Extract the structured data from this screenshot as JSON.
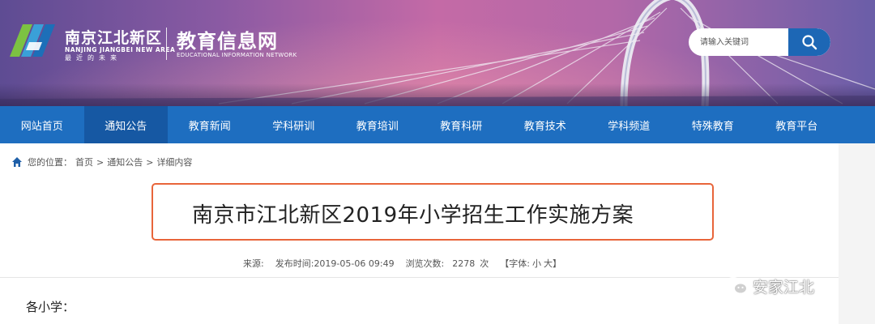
{
  "header": {
    "brand_cn": "南京江北新区",
    "brand_en": "NANJING JIANGBEI NEW AREA",
    "brand_slogan": "最近的未来",
    "site_title": "教育信息网",
    "site_subtitle": "EDUCATIONAL INFORMATION NETWORK",
    "search": {
      "placeholder": "请输入关键词"
    }
  },
  "nav": {
    "items": [
      {
        "label": "网站首页"
      },
      {
        "label": "通知公告"
      },
      {
        "label": "教育新闻"
      },
      {
        "label": "学科研训"
      },
      {
        "label": "教育培训"
      },
      {
        "label": "教育科研"
      },
      {
        "label": "教育技术"
      },
      {
        "label": "学科频道"
      },
      {
        "label": "特殊教育"
      },
      {
        "label": "教育平台"
      }
    ],
    "active_index": 1
  },
  "breadcrumb": {
    "prefix": "您的位置：",
    "items": [
      "首页",
      ">",
      "通知公告",
      ">",
      "详细内容"
    ]
  },
  "article": {
    "title": "南京市江北新区2019年小学招生工作实施方案",
    "meta": {
      "source_label": "来源:",
      "publish_label": "发布时间:",
      "publish_time": "2019-05-06 09:49",
      "views_label": "浏览次数:",
      "views": "2278",
      "views_unit": "次",
      "font_label": "【字体:",
      "font_small": "小",
      "font_large": "大",
      "font_close": "】"
    },
    "greeting": "各小学："
  },
  "watermark": {
    "text": "安家江北"
  },
  "colors": {
    "nav_bg": "#1e6ec0",
    "nav_active": "#1658a3",
    "search_button": "#1d67b5",
    "title_border": "#e8653a"
  }
}
